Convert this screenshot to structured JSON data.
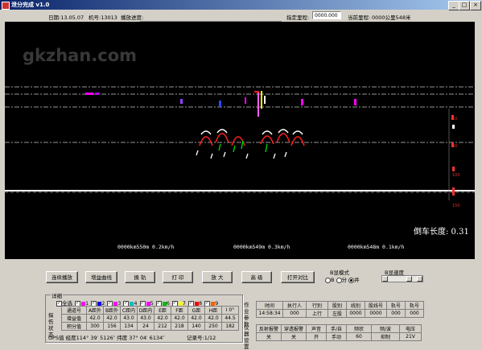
{
  "app": {
    "title": "泄分完成 v1.0"
  },
  "toolbar": {
    "date_label": "日期:13.05.07",
    "car_no_label": "机号:13013",
    "progress_label": "播放进度:",
    "mileage_label": "指定里程:",
    "mileage_value": "0000.000",
    "current_label": "当前里程:",
    "current_value": "0000公里548米"
  },
  "canvas": {
    "watermark": "gkzhan.com",
    "train_length": "倒车长度: 0.31",
    "speeds": [
      "0000km550m 0.2km/h",
      "0000km549m 0.3km/h",
      "0000km548m 0.1km/h"
    ],
    "ruler": [
      "10",
      "50",
      "100",
      "150"
    ]
  },
  "buttons": [
    "连续播放",
    "增益曲线",
    "换 轨",
    "打 印",
    "放 大",
    "高 级",
    "打开对比"
  ],
  "b_mode": {
    "label": "B显模式",
    "options": [
      "B",
      "分",
      "并"
    ],
    "selected": "并"
  },
  "b_speed": {
    "label": "B显速度"
  },
  "details": {
    "caption": "详细",
    "side_label": "探伤状态",
    "channels": [
      "全选",
      "1",
      "2",
      "3",
      "4",
      "5",
      "6",
      "7",
      "8",
      "9"
    ],
    "channel_colors": [
      "",
      "#ff00ff",
      "#0000ff",
      "#ff00ff",
      "#00c0c0",
      "#ff00ff",
      "#00c000",
      "#ffff00",
      "#ff0000",
      "#ff6000"
    ],
    "header": [
      "通道号",
      "A距外",
      "B距外",
      "C距内",
      "D距内",
      "E距",
      "F距",
      "G距",
      "H距",
      "I 0°"
    ],
    "rows": [
      [
        "增益值",
        "42.0",
        "42.0",
        "43.0",
        "43.0",
        "42.0",
        "42.0",
        "42.0",
        "42.0",
        "44.5"
      ],
      [
        "积分值",
        "300",
        "156",
        "134",
        "24",
        "212",
        "218",
        "140",
        "250",
        "182"
      ]
    ],
    "gps": "GPS值 经度114° 39′ 5126″ 纬度 37° 04′ 6134″",
    "record": "记录号:1/12"
  },
  "work": {
    "side_label": "作业参数",
    "header": [
      "时间",
      "执行人",
      "行别",
      "股别",
      "线别",
      "股线号",
      "轨号",
      "轨号"
    ],
    "row": [
      "14:58:34",
      "000",
      "上行",
      "左股",
      "0000",
      "0000",
      "000",
      "000"
    ]
  },
  "instr": {
    "side_label": "仪器设置",
    "header": [
      "反射报警",
      "穿透报警",
      "声音",
      "手/自",
      "频状",
      "频/波",
      "电压"
    ],
    "row": [
      "关",
      "关",
      "开",
      "手动",
      "60",
      "抑制",
      "21V"
    ]
  }
}
